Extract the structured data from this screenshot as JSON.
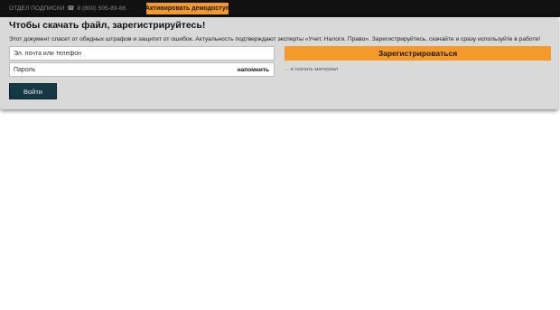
{
  "topbar": {
    "subscription_label": "ОТДЕЛ ПОДПИСКИ",
    "phone_icon": "☎",
    "phone": "8 (800) 505-89-86",
    "demo_button": "Активировать демодоступ"
  },
  "panel": {
    "title": "Чтобы скачать файл, зарегистрируйтесь!",
    "description": "Этот документ спасет от обидных штрафов и защитит от ошибок. Актуальность подтверждают эксперты «Учет. Налоги. Право». Зарегистрируйтесь, скачайте и сразу используйте в работе!",
    "email_placeholder": "Эл. почта или телефон",
    "password_placeholder": "Пароль",
    "remind_link": "напомнить",
    "register_button": "Зарегистрироваться",
    "download_note": "... и скачать материал",
    "login_button": "Войти"
  },
  "colors": {
    "accent": "#f39a2b",
    "topbar_bg": "#111111",
    "panel_bg": "#d9d9d9",
    "login_bg": "#143944"
  }
}
